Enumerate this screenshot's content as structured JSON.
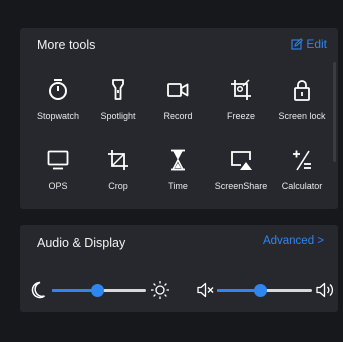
{
  "more_tools": {
    "title": "More tools",
    "edit_label": "Edit",
    "tools": [
      {
        "label": "Stopwatch",
        "icon": "stopwatch-icon"
      },
      {
        "label": "Spotlight",
        "icon": "spotlight-icon"
      },
      {
        "label": "Record",
        "icon": "record-icon"
      },
      {
        "label": "Freeze",
        "icon": "freeze-icon"
      },
      {
        "label": "Screen lock",
        "icon": "lock-icon"
      },
      {
        "label": "OPS",
        "icon": "monitor-icon"
      },
      {
        "label": "Crop",
        "icon": "crop-icon"
      },
      {
        "label": "Time",
        "icon": "hourglass-icon"
      },
      {
        "label": "ScreenShare",
        "icon": "screenshare-icon"
      },
      {
        "label": "Calculator",
        "icon": "calculator-icon"
      }
    ]
  },
  "audio_display": {
    "title": "Audio & Display",
    "advanced_label": "Advanced >",
    "brightness_level": 0.48,
    "volume_level": 0.45
  },
  "colors": {
    "accent": "#2e86f0",
    "panel": "#26282d",
    "background": "#17181c"
  }
}
